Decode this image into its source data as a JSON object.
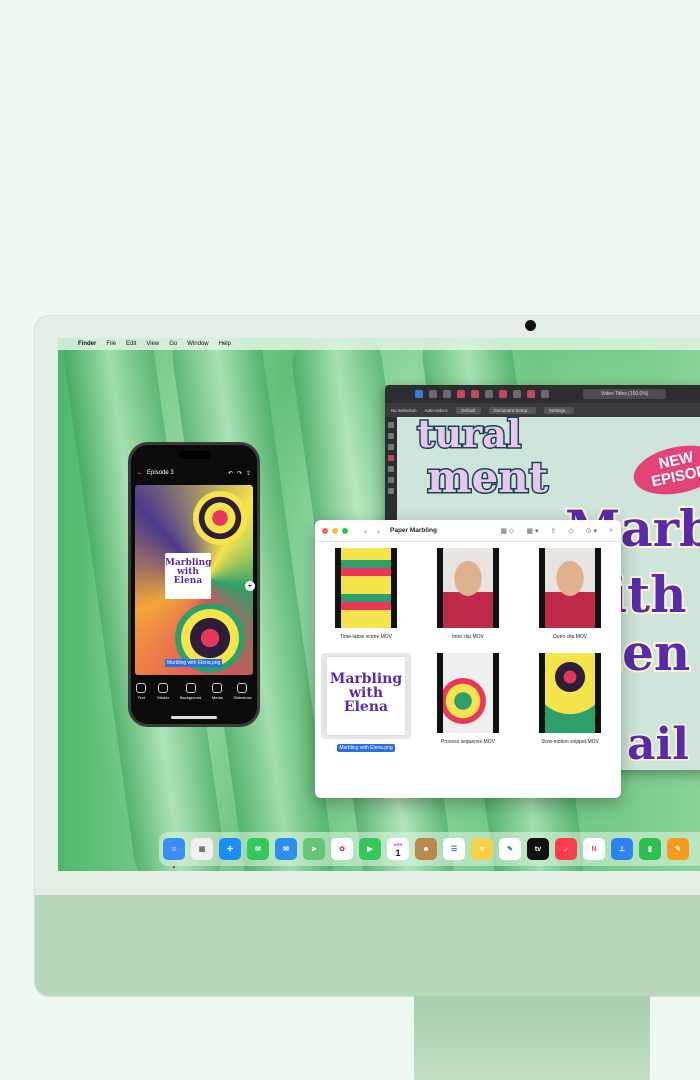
{
  "menubar": {
    "apple": "",
    "app_name": "Finder",
    "items": [
      "File",
      "Edit",
      "View",
      "Go",
      "Window",
      "Help"
    ]
  },
  "affinity": {
    "title": "Video Titles (150.0%)",
    "context_items": [
      "No Selection",
      "Auto-select:",
      "Default",
      "Document Setup...",
      "Settings..."
    ],
    "canvas_text": {
      "line1": "tural",
      "line2": "ment",
      "badge": "NEW EPISOD",
      "m1": "Marb",
      "m2": "with",
      "m3": "Elen",
      "bottom": "ail"
    }
  },
  "phone": {
    "title": "Episode 3",
    "sticker_text": "Marbling with Elena",
    "file_label": "Marbling with Elena.png",
    "tools": [
      "Text",
      "Sticker",
      "Background",
      "Media",
      "Slideshow"
    ]
  },
  "finder": {
    "title": "Paper Marbling",
    "files": [
      {
        "name": "Time-lapse scene.MOV",
        "kind": "video"
      },
      {
        "name": "Intro clip.MOV",
        "kind": "video"
      },
      {
        "name": "Outro clip.MOV",
        "kind": "video"
      },
      {
        "name": "Marbling with Elena.png",
        "kind": "image",
        "selected": true,
        "sticker_text": "Marbling with Elena"
      },
      {
        "name": "Process sequence.MOV",
        "kind": "video"
      },
      {
        "name": "Slow-motion snippet.MOV",
        "kind": "video"
      }
    ]
  },
  "dock": {
    "apps": [
      {
        "name": "Finder",
        "color": "#3a8ef5",
        "label": "☺"
      },
      {
        "name": "Launchpad",
        "color": "#f0f0f0",
        "label": "▦"
      },
      {
        "name": "Safari",
        "color": "#1d8cf7",
        "label": "✣"
      },
      {
        "name": "Messages",
        "color": "#34c759",
        "label": "✉"
      },
      {
        "name": "Mail",
        "color": "#2d8ef0",
        "label": "✉"
      },
      {
        "name": "Maps",
        "color": "#66c37a",
        "label": "➤"
      },
      {
        "name": "Photos",
        "color": "#ffffff",
        "label": "✿"
      },
      {
        "name": "FaceTime",
        "color": "#34c759",
        "label": "▶"
      },
      {
        "name": "Calendar",
        "color": "#ffffff",
        "label": "1"
      },
      {
        "name": "Contacts",
        "color": "#b9884a",
        "label": "☻"
      },
      {
        "name": "Reminders",
        "color": "#ffffff",
        "label": "☰"
      },
      {
        "name": "Notes",
        "color": "#f7d14c",
        "label": "≡"
      },
      {
        "name": "Freeform",
        "color": "#ffffff",
        "label": "✎"
      },
      {
        "name": "TV",
        "color": "#111111",
        "label": "tv"
      },
      {
        "name": "Music",
        "color": "#fa3c4c",
        "label": "♪"
      },
      {
        "name": "News",
        "color": "#ffffff",
        "label": "N"
      },
      {
        "name": "Keynote",
        "color": "#2f82f0",
        "label": "⊥"
      },
      {
        "name": "Numbers",
        "color": "#2fbf4e",
        "label": "▮"
      },
      {
        "name": "Pages",
        "color": "#f89c1c",
        "label": "✎"
      }
    ],
    "calendar_month": "APR"
  }
}
